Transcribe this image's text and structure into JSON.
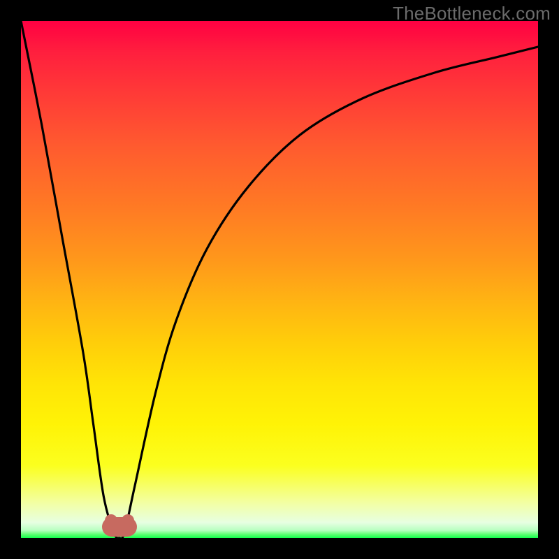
{
  "watermark": "TheBottleneck.com",
  "chart_data": {
    "type": "line",
    "title": "",
    "xlabel": "",
    "ylabel": "",
    "xlim": [
      0,
      100
    ],
    "ylim": [
      0,
      100
    ],
    "background_gradient": {
      "orientation": "vertical_top_to_bottom",
      "stops": [
        {
          "pct": 0,
          "color": "#ff0042"
        },
        {
          "pct": 14,
          "color": "#ff3a37"
        },
        {
          "pct": 36,
          "color": "#ff7a24"
        },
        {
          "pct": 62,
          "color": "#ffcd0a"
        },
        {
          "pct": 86,
          "color": "#fbff1f"
        },
        {
          "pct": 97,
          "color": "#e7ffe2"
        },
        {
          "pct": 100,
          "color": "#11ff4c"
        }
      ]
    },
    "series": [
      {
        "name": "bottleneck-curve",
        "x": [
          0,
          4,
          8,
          12,
          14,
          16,
          18,
          19,
          20,
          22,
          26,
          30,
          36,
          44,
          54,
          66,
          80,
          92,
          100
        ],
        "y": [
          100,
          80,
          58,
          36,
          22,
          8,
          1,
          0,
          1,
          10,
          28,
          42,
          56,
          68,
          78,
          85,
          90,
          93,
          95
        ]
      }
    ],
    "marker": {
      "name": "optimal-blob",
      "x": 19,
      "y": 0,
      "color": "#c76a60"
    }
  }
}
